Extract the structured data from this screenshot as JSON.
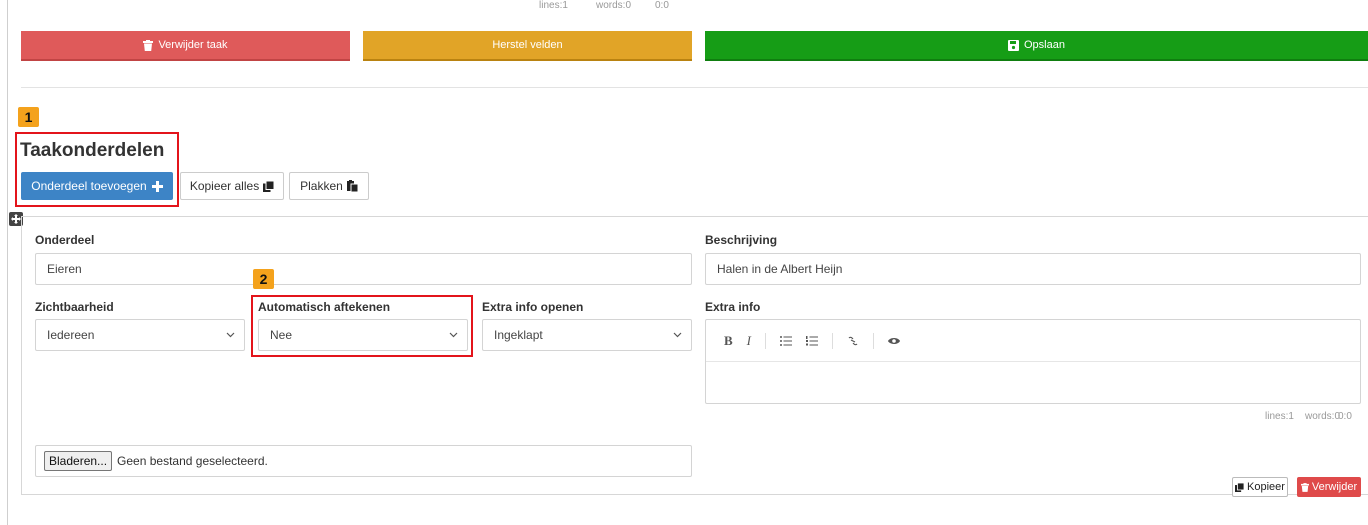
{
  "top_status": {
    "lines": "lines:1",
    "words": "words:0",
    "pos": "0:0"
  },
  "top_buttons": {
    "delete_task": "Verwijder taak",
    "reset_fields": "Herstel velden",
    "save": "Opslaan"
  },
  "badges": {
    "one": "1",
    "two": "2"
  },
  "section": {
    "title": "Taakonderdelen",
    "add_part": "Onderdeel toevoegen",
    "copy_all": "Kopieer alles",
    "paste": "Plakken"
  },
  "part": {
    "onderdeel_label": "Onderdeel",
    "onderdeel_value": "Eieren",
    "beschrijving_label": "Beschrijving",
    "beschrijving_value": "Halen in de Albert Heijn",
    "zichtbaarheid_label": "Zichtbaarheid",
    "zichtbaarheid_value": "Iedereen",
    "auto_label": "Automatisch aftekenen",
    "auto_value": "Nee",
    "extra_open_label": "Extra info openen",
    "extra_open_value": "Ingeklapt",
    "extra_info_label": "Extra info",
    "editor_status": {
      "lines": "lines:1",
      "words": "words:0",
      "pos": "0:0"
    },
    "file_button": "Bladeren...",
    "file_status": "Geen bestand geselecteerd.",
    "copy": "Kopieer",
    "delete": "Verwijder"
  },
  "colors": {
    "red": "#df5a5a",
    "orange": "#e1a427",
    "green": "#169d16",
    "blue": "#3d84c6",
    "badge": "#f4a21c",
    "highlight": "#e3141b"
  }
}
